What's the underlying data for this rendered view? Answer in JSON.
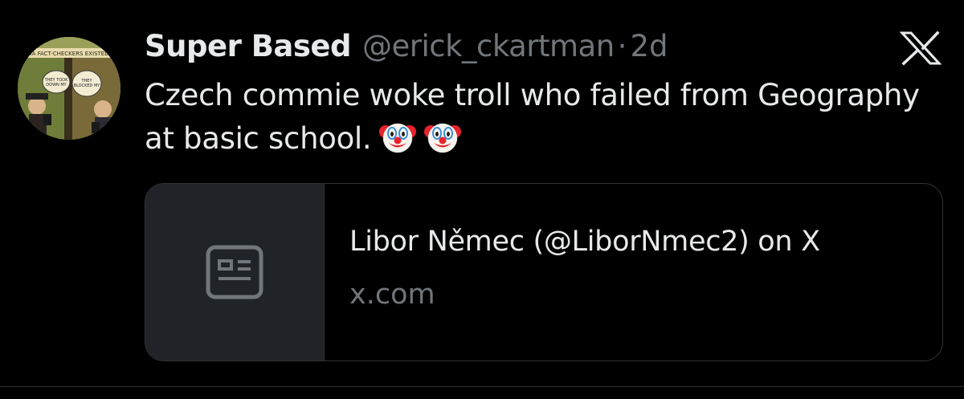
{
  "tweet": {
    "display_name": "Super Based",
    "handle": "@erick_ckartman",
    "separator": "·",
    "time": "2d",
    "text": "Czech commie woke troll who failed from Geography at basic school.",
    "emojis": [
      "clown-face",
      "clown-face"
    ]
  },
  "avatar": {
    "banner_text": "SOCIAL MEDIA FACT-CHECKERS EXISTED BACK THEN",
    "left_panel_text": "THEY TOOK DOWN MY EARTH IS ROUND POST!",
    "right_panel_text": "THEY BLOCKED MY \"EARTH REVOLVES AROUND THE SUN\" POST!"
  },
  "link_card": {
    "title": "Libor Němec (@LiborNmec2) on X",
    "domain": "x.com",
    "thumbnail_icon": "article-icon"
  },
  "toolbar": {
    "close_icon": "x-logo-close-icon"
  },
  "colors": {
    "background": "#000000",
    "primary_text": "#e7e9ea",
    "secondary_text": "#71767b",
    "border": "#2f3336",
    "card_thumb_bg": "#202327"
  }
}
